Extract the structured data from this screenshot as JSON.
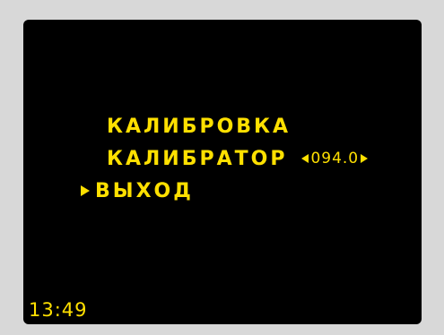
{
  "colors": {
    "background": "#d8d8d8",
    "screen": "#000000",
    "text": "#ffe000"
  },
  "menu": {
    "items": [
      {
        "label": "КАЛИБРОВКА",
        "selected": false
      },
      {
        "label": "КАЛИБРАТОР",
        "selected": false,
        "value": "094.0",
        "value_adjustable": true
      },
      {
        "label": "ВЫХОД",
        "selected": true
      }
    ],
    "cursor_icon": "triangle-right-icon"
  },
  "status": {
    "time": "13:49"
  }
}
